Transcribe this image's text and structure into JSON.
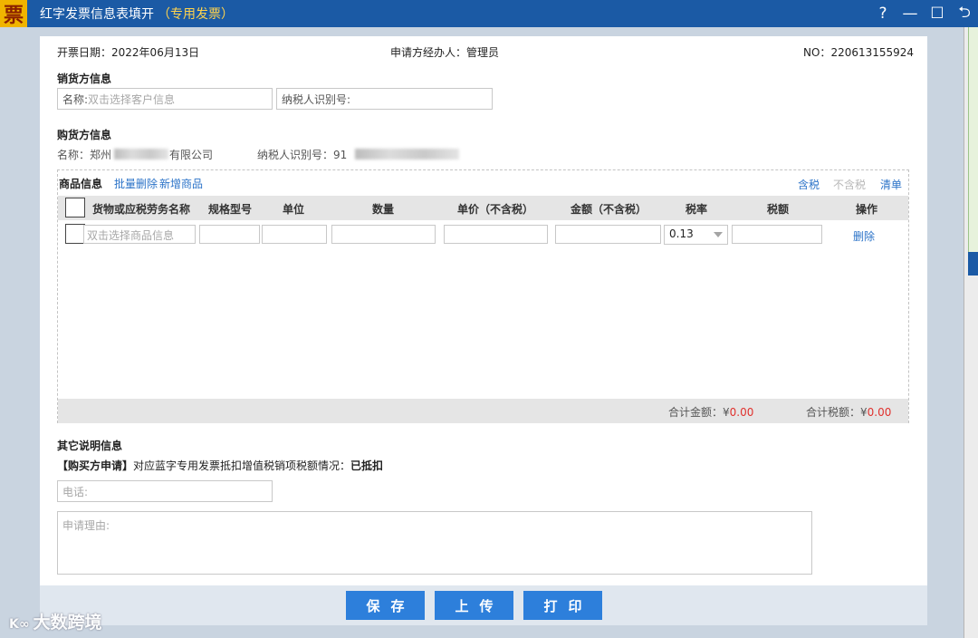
{
  "window": {
    "logo_char": "票",
    "title": "红字发票信息表填开",
    "title_tag": "（专用发票）",
    "help": "?",
    "minimize": "—",
    "maximize": "☐",
    "back": "⮌"
  },
  "header": {
    "date_label": "开票日期：",
    "date_value": "2022年06月13日",
    "handler_label": "申请方经办人：",
    "handler_value": "管理员",
    "no_label": "NO：",
    "no_value": "220613155924"
  },
  "seller": {
    "section_title": "销货方信息",
    "name_label": "名称:",
    "name_placeholder": "双击选择客户信息",
    "taxid_label": "纳税人识别号:"
  },
  "buyer": {
    "section_title": "购货方信息",
    "name_label": "名称：",
    "name_value": "郑州",
    "name_suffix": "有限公司",
    "taxid_label": "纳税人识别号：",
    "taxid_value": "91"
  },
  "goods": {
    "section_title": "商品信息",
    "batch_delete": "批量删除",
    "add_item": "新增商品",
    "tax_included": "含税",
    "tax_excluded": "不含税",
    "list": "清单",
    "columns": [
      "货物或应税劳务名称",
      "规格型号",
      "单位",
      "数量",
      "单价（不含税）",
      "金额（不含税）",
      "税率",
      "税额",
      "操作"
    ],
    "row": {
      "name_placeholder": "双击选择商品信息",
      "tax_rate": "0.13",
      "delete": "删除"
    },
    "total_amount_label": "合计金额：",
    "total_amount_currency": "¥",
    "total_amount_value": "0.00",
    "total_tax_label": "合计税额：",
    "total_tax_currency": "¥",
    "total_tax_value": "0.00"
  },
  "other": {
    "section_title": "其它说明信息",
    "buyer_apply": "【购买方申请】",
    "apply_text": "对应蓝字专用发票抵扣增值税销项税额情况：",
    "apply_status": "已抵扣",
    "phone_placeholder": "电话:",
    "reason_placeholder": "申请理由:"
  },
  "buttons": {
    "save": "保存",
    "upload": "上传",
    "print": "打印"
  },
  "watermark": "大数跨境"
}
